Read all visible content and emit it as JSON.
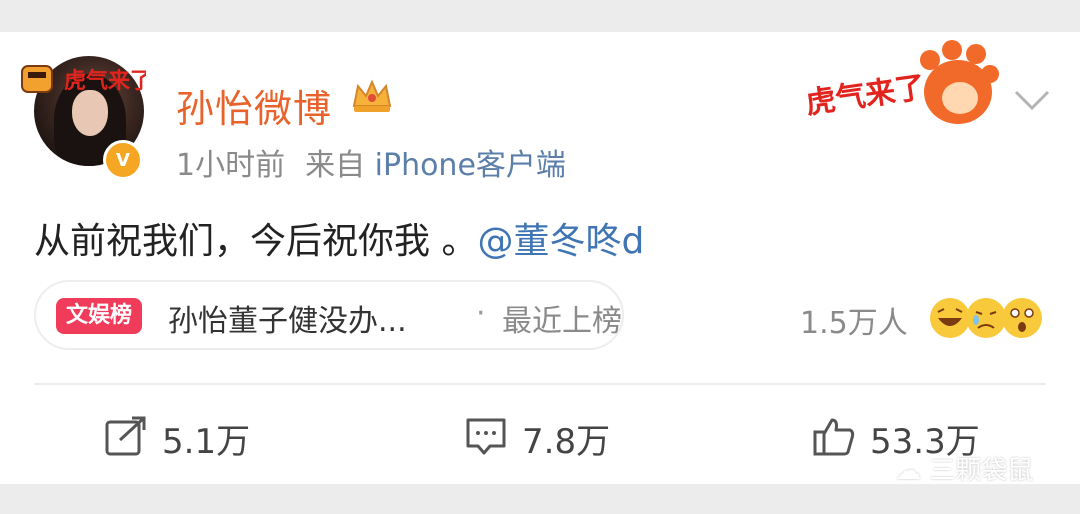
{
  "post": {
    "username": "孙怡微博",
    "time": "1小时前",
    "source_prefix": "来自",
    "source_device": "iPhone客户端",
    "content_text": "从前祝我们，今后祝你我 。",
    "mention": "@董冬咚d"
  },
  "hot": {
    "tag": "文娱榜",
    "title": "孙怡董子健没办...",
    "separator": "·",
    "status": "最近上榜"
  },
  "reactions": {
    "count_label": "1.5万人",
    "emojis": [
      "laugh-emoji",
      "cry-emoji",
      "surprised-emoji"
    ]
  },
  "actions": {
    "share": "5.1万",
    "comment": "7.8万",
    "like": "53.3万"
  },
  "decor": {
    "tiger_text": "虎气来了"
  },
  "watermark": {
    "text": "三颗袋鼠"
  },
  "colors": {
    "username": "#e8632c",
    "mention": "#3f75b4",
    "hot_tag": "#f03c5a",
    "background": "#ececec"
  }
}
